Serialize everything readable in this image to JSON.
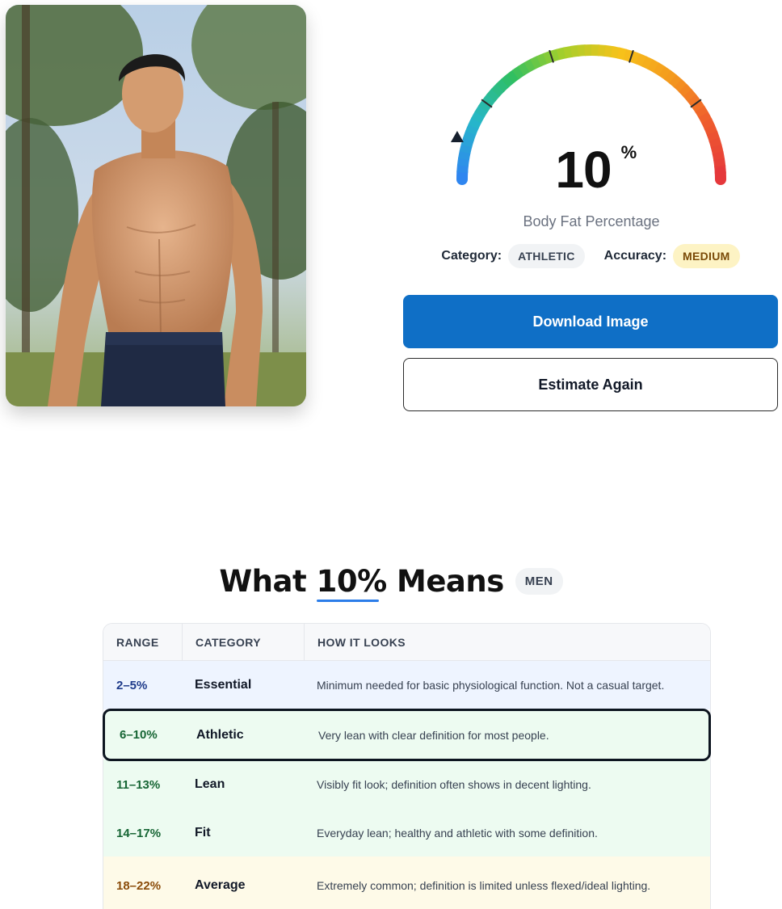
{
  "gauge": {
    "value": "10",
    "unit": "%",
    "caption": "Body Fat Percentage",
    "fraction": 0.1
  },
  "meta": {
    "category_label": "Category:",
    "category_value": "ATHLETIC",
    "accuracy_label": "Accuracy:",
    "accuracy_value": "MEDIUM"
  },
  "buttons": {
    "download": "Download Image",
    "again": "Estimate Again"
  },
  "section": {
    "title_prefix": "What ",
    "title_highlight": "10%",
    "title_suffix": " Means",
    "sex": "MEN"
  },
  "table": {
    "headers": [
      "RANGE",
      "CATEGORY",
      "HOW IT LOOKS"
    ],
    "rows": [
      {
        "range": "2–5%",
        "category": "Essential",
        "description": "Minimum needed for basic physiological function. Not a casual target."
      },
      {
        "range": "6–10%",
        "category": "Athletic",
        "description": "Very lean with clear definition for most people."
      },
      {
        "range": "11–13%",
        "category": "Lean",
        "description": "Visibly fit look; definition often shows in decent lighting."
      },
      {
        "range": "14–17%",
        "category": "Fit",
        "description": "Everyday lean; healthy and athletic with some definition."
      },
      {
        "range": "18–22%",
        "category": "Average",
        "description": "Extremely common; definition is limited unless flexed/ideal lighting."
      }
    ],
    "selected_index": 1
  },
  "colors": {
    "primary": "#0f6fc6",
    "highlight_border": "#0d1520",
    "accent_underline": "#2b7de9"
  }
}
